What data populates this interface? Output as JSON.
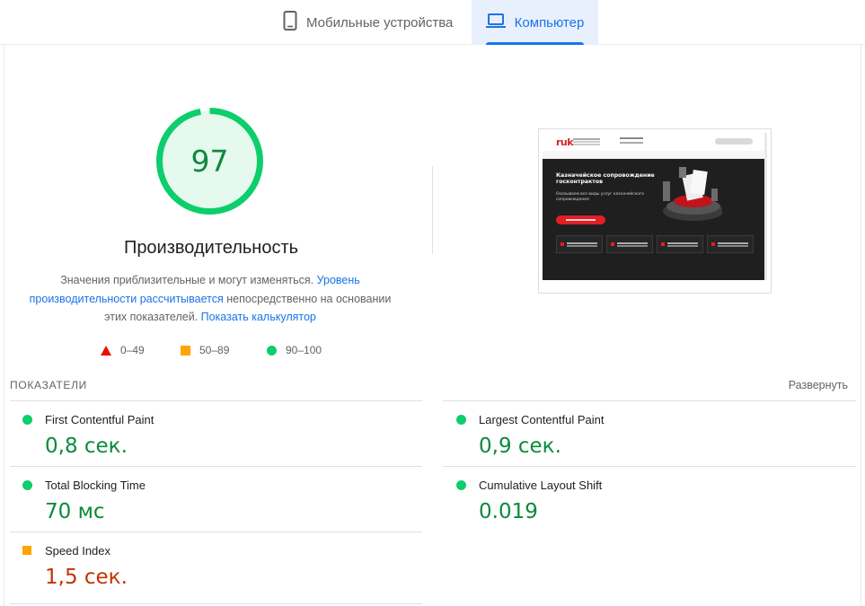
{
  "tabs": {
    "mobile_label": "Мобильные устройства",
    "desktop_label": "Компьютер"
  },
  "score": {
    "value": 97,
    "fraction": 0.97,
    "title": "Производительность",
    "color": "#0cce6b"
  },
  "description": {
    "text1": "Значения приблизительные и могут изменяться. ",
    "link1": "Уровень производительности рассчитывается",
    "text2": " непосредственно на основании этих показателей. ",
    "link2": "Показать калькулятор"
  },
  "legend": {
    "fail": "0–49",
    "average": "50–89",
    "pass": "90–100",
    "colors": {
      "fail": "#eb0f00",
      "average": "#ffa400",
      "pass": "#0cce6b"
    }
  },
  "thumbnail": {
    "logo": "ruk",
    "hero_title": "Казначейское сопровождение госконтрактов",
    "hero_sub": "Оказываем все виды услуг казначейского сопровождения"
  },
  "metrics": {
    "header": "ПОКАЗАТЕЛИ",
    "expand_label": "Развернуть",
    "fcp": {
      "label": "First Contentful Paint",
      "value": "0,8 сек.",
      "status": "pass"
    },
    "lcp": {
      "label": "Largest Contentful Paint",
      "value": "0,9 сек.",
      "status": "pass"
    },
    "tbt": {
      "label": "Total Blocking Time",
      "value": "70 мс",
      "status": "pass"
    },
    "cls": {
      "label": "Cumulative Layout Shift",
      "value": "0.019",
      "status": "pass"
    },
    "si": {
      "label": "Speed Index",
      "value": "1,5 сек.",
      "status": "average"
    }
  }
}
